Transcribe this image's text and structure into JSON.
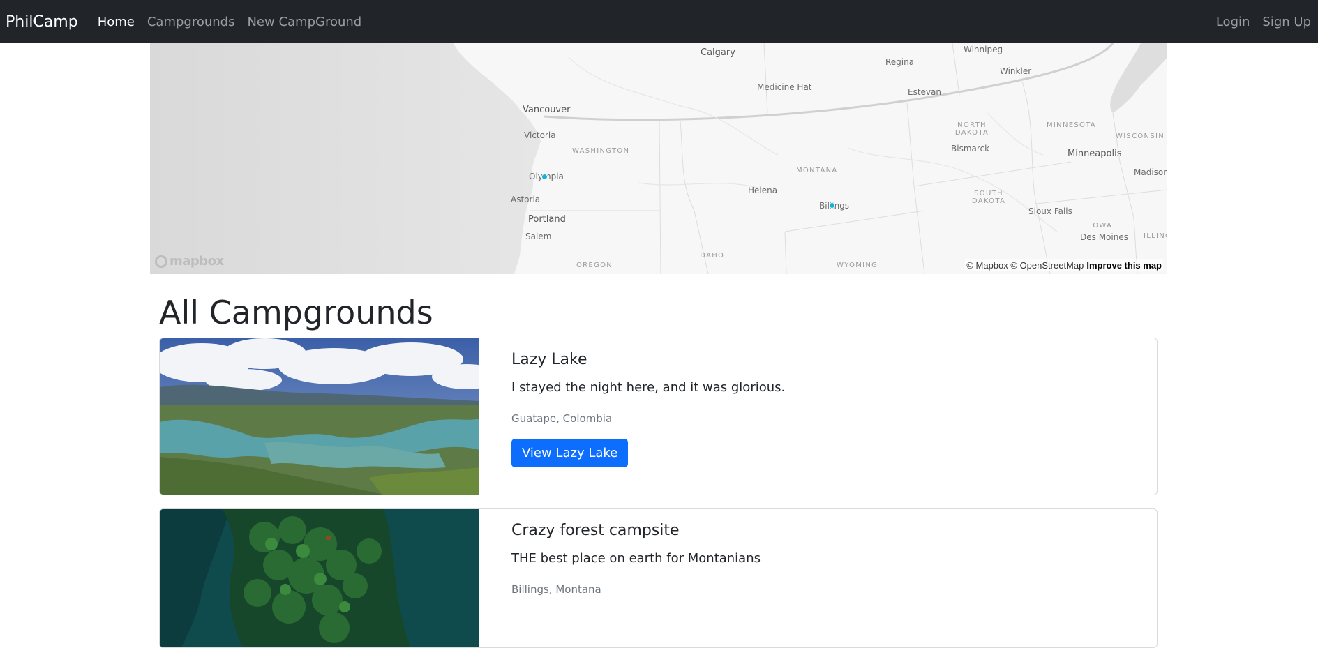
{
  "navbar": {
    "brand": "PhilCamp",
    "links": [
      "Home",
      "Campgrounds",
      "New CampGround"
    ],
    "right_links": [
      "Login",
      "Sign Up"
    ],
    "background": "#212529"
  },
  "map": {
    "cities": [
      "Calgary",
      "Regina",
      "Winnipeg",
      "Winkler",
      "Medicine Hat",
      "Estevan",
      "Vancouver",
      "Victoria",
      "Olympia",
      "Astoria",
      "Portland",
      "Salem",
      "Helena",
      "Billings",
      "Bismarck",
      "Minneapolis",
      "Madison",
      "Sioux Falls",
      "Des Moines"
    ],
    "states": [
      "WASHINGTON",
      "OREGON",
      "IDAHO",
      "MONTANA",
      "WYOMING",
      "NORTH DAKOTA",
      "SOUTH DAKOTA",
      "MINNESOTA",
      "WISCONSIN",
      "IOWA",
      "ILLINOIS"
    ],
    "markers": [
      "Olympia",
      "Billings"
    ],
    "marker_color": "#11b4da",
    "logo": "mapbox",
    "attribution": "© Mapbox © OpenStreetMap",
    "improve_link": "Improve this map"
  },
  "page_title": "All Campgrounds",
  "campgrounds": [
    {
      "title": "Lazy Lake",
      "description": "I stayed the night here, and it was glorious.",
      "location": "Guatape, Colombia",
      "button": "View Lazy Lake"
    },
    {
      "title": "Crazy forest campsite",
      "description": "THE best place on earth for Montanians",
      "location": "Billings, Montana"
    }
  ],
  "accent_color": "#0d6efd"
}
